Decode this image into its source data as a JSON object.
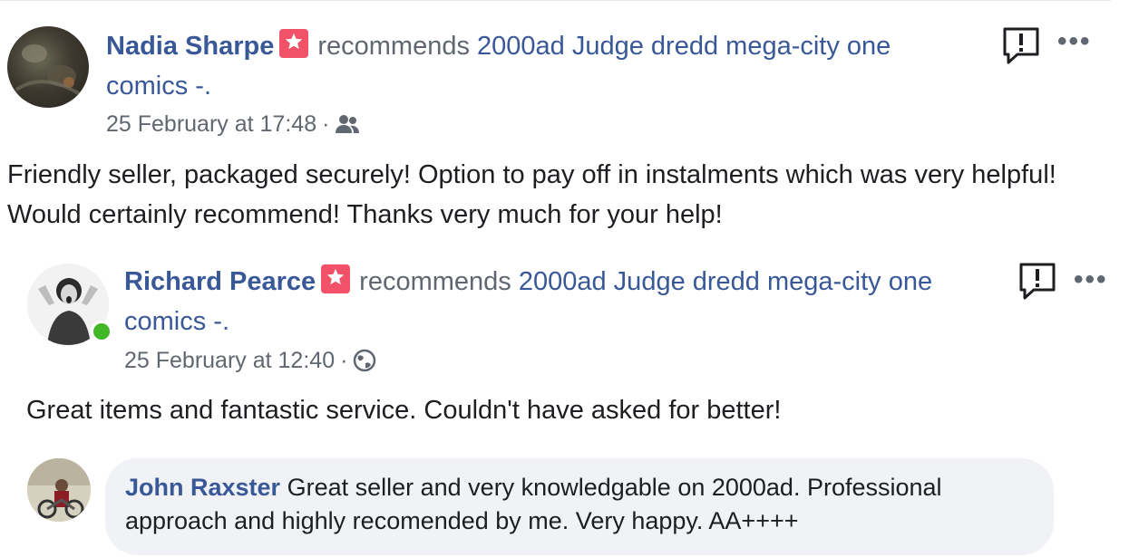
{
  "posts": [
    {
      "author": "Nadia Sharpe",
      "recommends_text": "recommends",
      "page_name": "2000ad Judge dredd mega-city one",
      "page_name_cont": "comics -.",
      "timestamp": "25 February at 17:48",
      "separator": "·",
      "audience_icon": "friends-icon",
      "body": "Friendly seller, packaged securely! Option to pay off in instalments which was very helpful! Would certainly recommend! Thanks very much for your help!"
    },
    {
      "author": "Richard Pearce",
      "recommends_text": "recommends",
      "page_name": "2000ad Judge dredd mega-city one",
      "page_name_cont": "comics -.",
      "timestamp": "25 February at 12:40",
      "separator": "·",
      "audience_icon": "globe-icon",
      "online": true,
      "body": "Great items and fantastic service. Couldn't have asked for better!"
    }
  ],
  "comment": {
    "author": "John Raxster",
    "text": "Great seller and very knowledgable on 2000ad. Professional approach and highly recomended by me. Very happy. AA++++"
  },
  "colors": {
    "link": "#385898",
    "badge": "#f25268",
    "online": "#42b72a",
    "bubble": "#f0f2f5"
  }
}
